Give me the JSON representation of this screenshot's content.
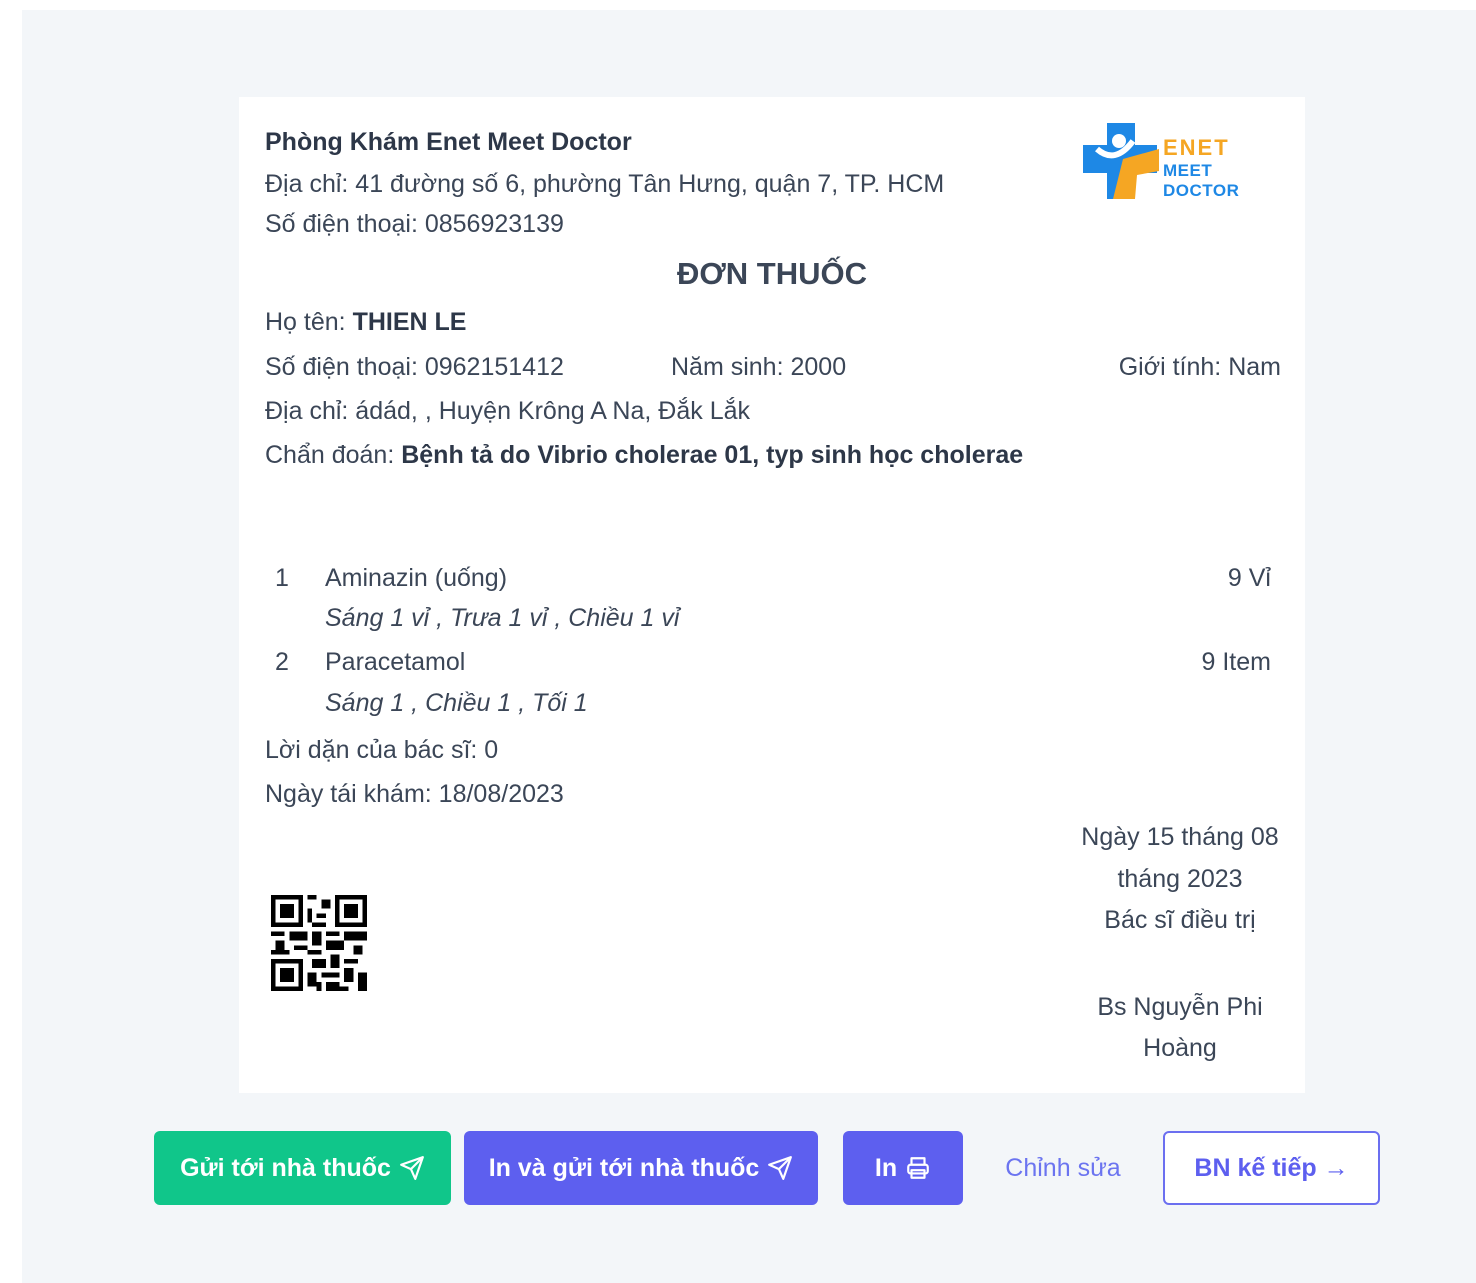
{
  "clinic": {
    "name": "Phòng Khám Enet Meet Doctor",
    "address": "Địa chỉ: 41 đường số 6, phường Tân Hưng, quận 7, TP. HCM",
    "phone": "Số điện thoại: 0856923139",
    "logo_line1": "ENET",
    "logo_line2": "MEET DOCTOR"
  },
  "title": "ĐƠN THUỐC",
  "patient": {
    "name_label": "Họ tên: ",
    "name": "THIEN LE",
    "phone": "Số điện thoại: 0962151412",
    "birth_year": "Năm sinh: 2000",
    "gender": "Giới tính: Nam",
    "address": "Địa chỉ: ádád, , Huyện Krông A Na, Đắk Lắk",
    "diagnosis_label": "Chẩn đoán: ",
    "diagnosis": "Bệnh tả do Vibrio cholerae 01, typ sinh học cholerae"
  },
  "medicines": [
    {
      "index": "1",
      "name": "Aminazin (uống)",
      "dosage": "Sáng 1 vỉ , Trưa 1 vỉ , Chiều 1 vỉ",
      "quantity": "9 Vỉ"
    },
    {
      "index": "2",
      "name": "Paracetamol",
      "dosage": "Sáng 1 , Chiều 1 , Tối 1",
      "quantity": "9 Item"
    }
  ],
  "advice": "Lời dặn của bác sĩ: 0",
  "revisit": "Ngày tái khám: 18/08/2023",
  "signature": {
    "date_line1": "Ngày 15 tháng 08",
    "date_line2": "tháng 2023",
    "role": "Bác sĩ điều trị",
    "doctor_line1": "Bs Nguyễn Phi",
    "doctor_line2": "Hoàng"
  },
  "actions": {
    "send": "Gửi tới nhà thuốc",
    "print_send": "In và gửi tới nhà thuốc",
    "print": "In",
    "edit": "Chỉnh sửa",
    "next": "BN kế tiếp →"
  },
  "colors": {
    "green": "#10c68a",
    "indigo": "#5d5fef",
    "logo_orange": "#f5a623",
    "logo_blue": "#1e88e5"
  }
}
